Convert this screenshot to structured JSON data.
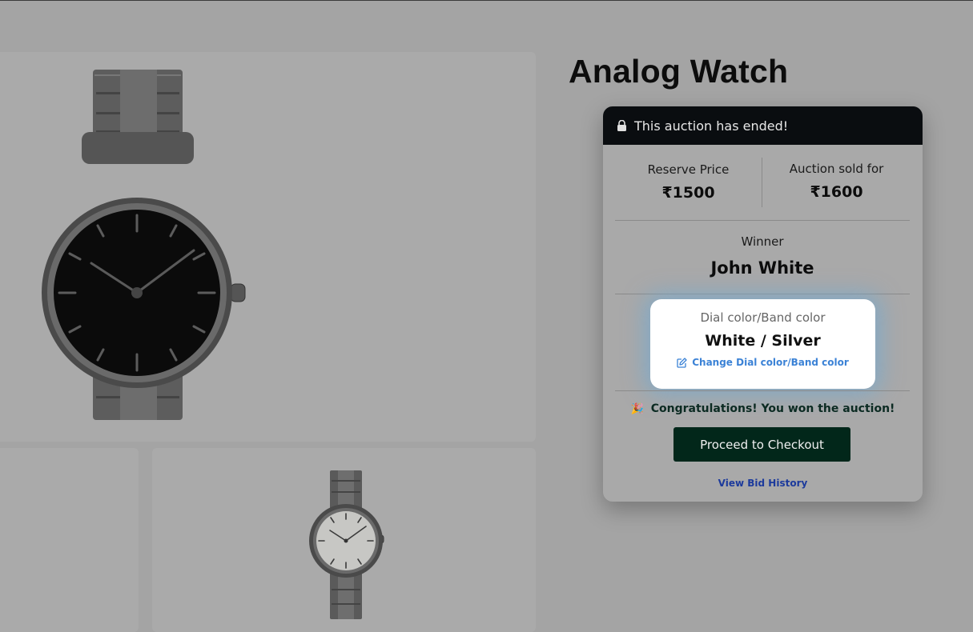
{
  "product": {
    "title": "Analog Watch"
  },
  "auction": {
    "status_text": "This auction has ended!",
    "reserve_label": "Reserve Price",
    "reserve_value": "₹1500",
    "sold_label": "Auction sold for",
    "sold_value": "₹1600",
    "winner_label": "Winner",
    "winner_name": "John White",
    "dial_label": "Dial color/Band color",
    "dial_value": "White / Silver",
    "change_link": "Change Dial color/Band color",
    "congrats_text": "Congratulations! You won the auction!",
    "checkout_label": "Proceed to Checkout",
    "history_link": "View Bid History"
  },
  "icons": {
    "header": "lock-icon",
    "change": "edit-icon",
    "congrats": "party-popper-icon"
  },
  "colors": {
    "overlay": "#a4a4a4",
    "header_bg": "#0a0d10",
    "checkout_bg": "#02271a",
    "link_blue": "#3b82d6",
    "history_blue": "#1c3a9c",
    "highlight_glow": "#78aacd"
  }
}
